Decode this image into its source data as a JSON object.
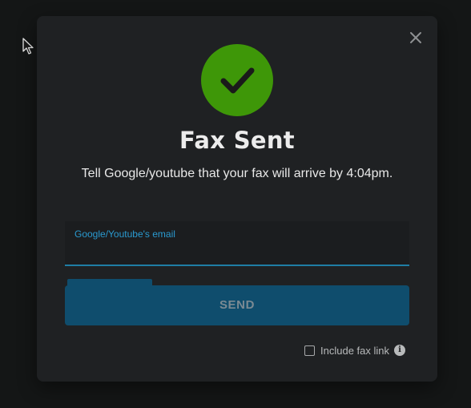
{
  "modal": {
    "title": "Fax Sent",
    "message": "Tell Google/youtube that your fax will arrive by 4:04pm.",
    "icons": {
      "close": "close-icon",
      "success": "checkmark-icon",
      "info": "info-icon",
      "cursor": "mouse-pointer-icon"
    },
    "colors": {
      "success_green": "#3e9708",
      "accent_blue": "#2a9ad0",
      "button_blue": "#0f4d6d"
    }
  },
  "email_field": {
    "label": "Google/Youtube's email",
    "value": ""
  },
  "send_progress": 0.25,
  "send_button": {
    "label": "SEND"
  },
  "fax_link": {
    "checked": false,
    "label": "Include fax link",
    "info_glyph": "i"
  }
}
